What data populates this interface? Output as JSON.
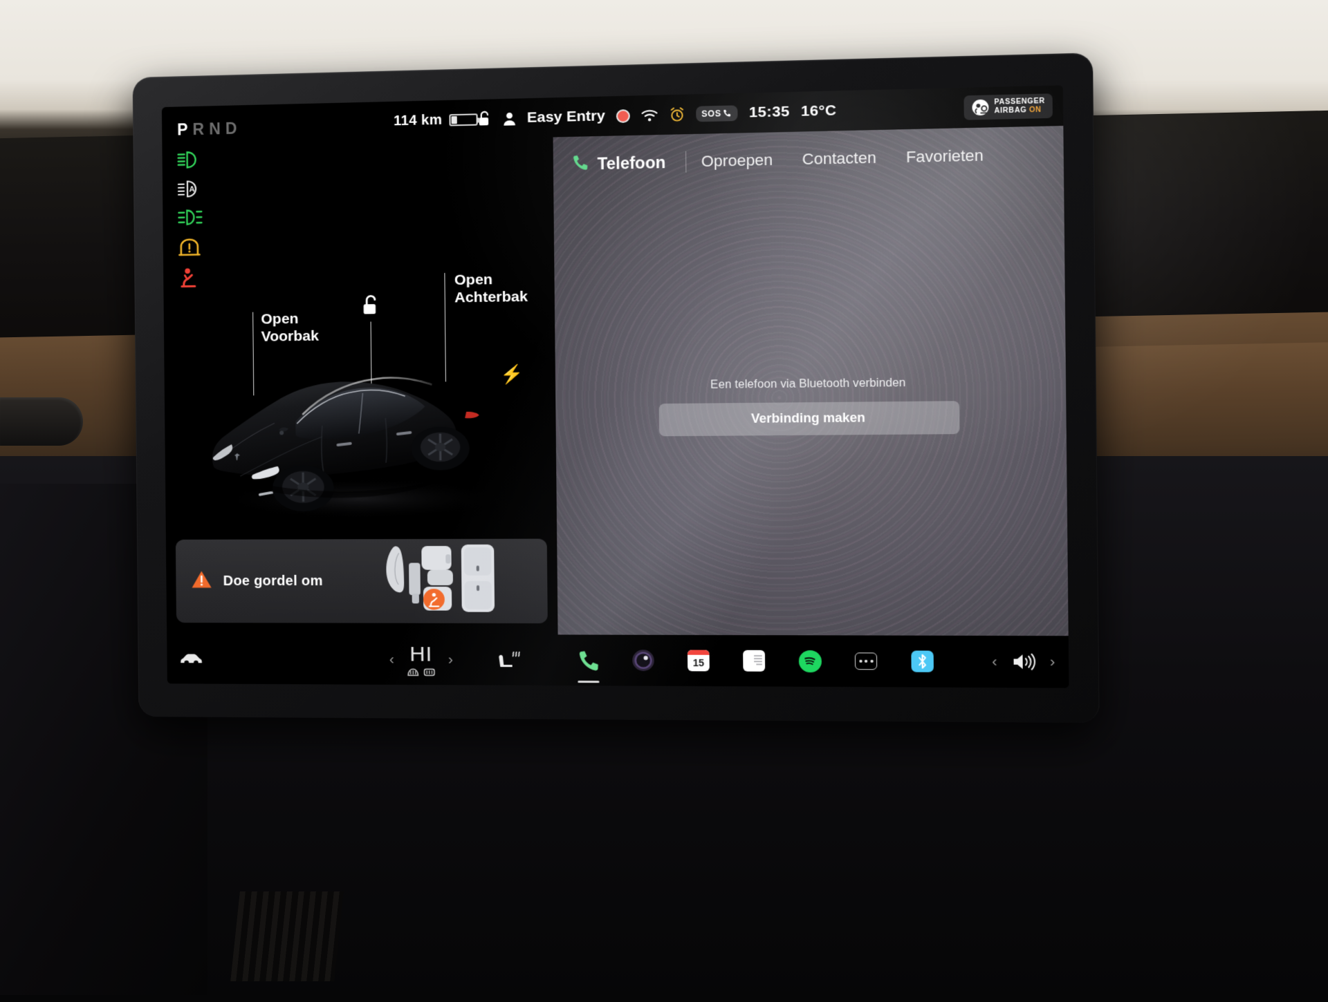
{
  "status_bar": {
    "gear_indicator": "PRND",
    "gear_active": "P",
    "range": "114 km",
    "battery_icon": "battery-low-icon",
    "lock_icon": "unlock-icon",
    "profile_icon": "person-icon",
    "profile_name": "Easy Entry",
    "recording_icon": "dashcam-record-icon",
    "wifi_icon": "wifi-icon",
    "alarm_icon": "alarm-clock-icon",
    "sos_label": "SOS",
    "time": "15:35",
    "temperature": "16°C",
    "airbag_icon": "passenger-airbag-icon",
    "airbag_line1": "PASSENGER",
    "airbag_line2": "AIRBAG",
    "airbag_state": "ON"
  },
  "telltales": [
    {
      "name": "high-beam-icon",
      "color": "#32d35a",
      "label": "Grootlicht"
    },
    {
      "name": "auto-high-beam-icon",
      "color": "#e8e8e8",
      "label": "Automatisch grootlicht"
    },
    {
      "name": "fog-lights-icon",
      "color": "#32d35a",
      "label": "Mistlampen"
    },
    {
      "name": "tire-pressure-warning-icon",
      "color": "#f0b429",
      "label": "Bandenspanning"
    },
    {
      "name": "seatbelt-warning-icon",
      "color": "#ef4136",
      "label": "Gordel"
    }
  ],
  "car_view": {
    "front_trunk_label_line1": "Open",
    "front_trunk_label_line2": "Voorbak",
    "rear_trunk_label_line1": "Open",
    "rear_trunk_label_line2": "Achterbak",
    "unlock_icon": "unlock-icon",
    "charge_port_icon": "charge-bolt-icon",
    "vehicle": "tesla-model-3-black"
  },
  "seatbelt_card": {
    "warning_icon": "warning-triangle-icon",
    "message": "Doe gordel om",
    "seat_diagram_icon": "seat-layout-icon",
    "alert_seat": "front-passenger"
  },
  "phone_app": {
    "phone_icon": "phone-handset-icon",
    "title": "Telefoon",
    "tabs": [
      {
        "label": "Oproepen",
        "active": false
      },
      {
        "label": "Contacten",
        "active": false
      },
      {
        "label": "Favorieten",
        "active": false
      }
    ],
    "bluetooth_hint": "Een telefoon via Bluetooth verbinden",
    "connect_button": "Verbinding maken"
  },
  "dock": {
    "car_icon": "car-controls-icon",
    "climate_prev_icon": "chevron-left-icon",
    "climate_temp": "HI",
    "climate_next_icon": "chevron-right-icon",
    "defrost_front_icon": "defrost-front-icon",
    "defrost_rear_icon": "defrost-rear-icon",
    "heated_seat_icon": "heated-seat-icon",
    "apps": [
      {
        "name": "phone-app-icon",
        "label": "Telefoon",
        "active": true
      },
      {
        "name": "camera-app-icon",
        "label": "Camera",
        "active": false
      },
      {
        "name": "calendar-app-icon",
        "label": "Agenda",
        "badge": "15",
        "active": false
      },
      {
        "name": "notes-app-icon",
        "label": "Notities",
        "active": false
      },
      {
        "name": "spotify-app-icon",
        "label": "Spotify",
        "active": false
      },
      {
        "name": "more-apps-icon",
        "label": "Meer",
        "active": false
      },
      {
        "name": "bluetooth-app-icon",
        "label": "Bluetooth",
        "active": false
      }
    ],
    "volume_prev_icon": "chevron-left-icon",
    "volume_icon": "speaker-volume-icon",
    "volume_next_icon": "chevron-right-icon"
  },
  "colors": {
    "accent_green": "#32d35a",
    "warning_amber": "#f0b429",
    "warning_red": "#ef4136",
    "warning_orange": "#f26b2c",
    "spotify_green": "#1ed760",
    "bluetooth_blue": "#4cc8f5",
    "screen_black": "#000000"
  }
}
